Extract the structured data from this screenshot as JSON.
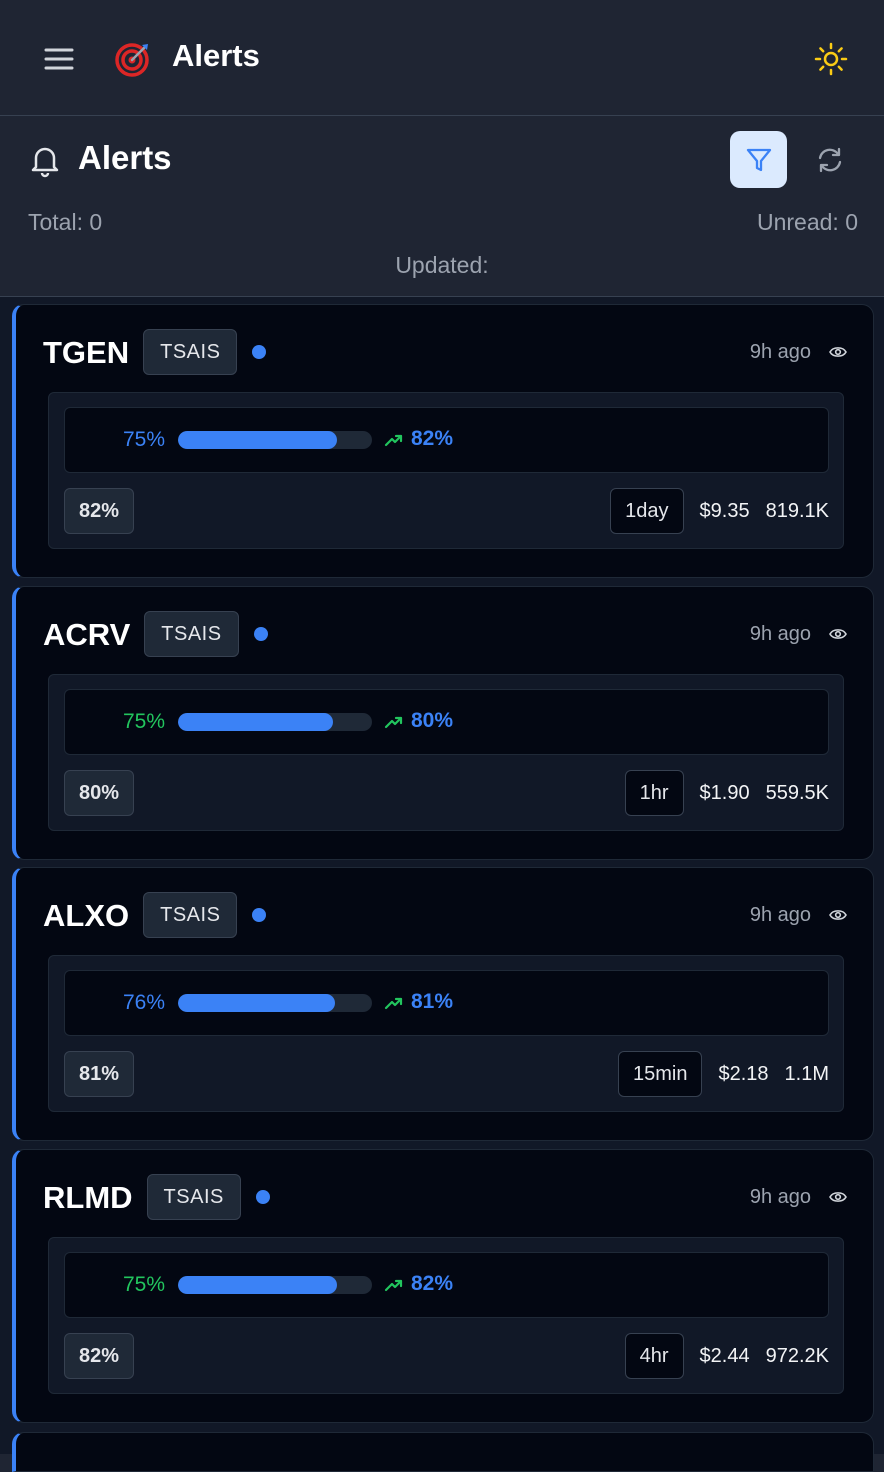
{
  "header": {
    "title": "Alerts",
    "icons": {
      "menu": "hamburger-icon",
      "logo": "target-icon",
      "theme": "sun-icon"
    },
    "colors": {
      "background": "#1f2533",
      "sun": "#facc15",
      "logo": "#dc2626"
    }
  },
  "subheader": {
    "title": "Alerts",
    "total": "Total: 0",
    "unread": "Unread: 0",
    "updated": "Updated:",
    "icons": {
      "bell": "bell-icon",
      "filter": "filter-icon",
      "refresh": "refresh-icon"
    }
  },
  "alerts": [
    {
      "ticker": "TGEN",
      "source": "TSAIS",
      "time": "9h ago",
      "start_pct": "75%",
      "start_color": "#3b82f6",
      "progress": 0.82,
      "end_pct": "82%",
      "confidence": "82%",
      "timeframe": "1day",
      "price": "$9.35",
      "volume": "819.1K"
    },
    {
      "ticker": "ACRV",
      "source": "TSAIS",
      "time": "9h ago",
      "start_pct": "75%",
      "start_color": "#22c55e",
      "progress": 0.8,
      "end_pct": "80%",
      "confidence": "80%",
      "timeframe": "1hr",
      "price": "$1.90",
      "volume": "559.5K"
    },
    {
      "ticker": "ALXO",
      "source": "TSAIS",
      "time": "9h ago",
      "start_pct": "76%",
      "start_color": "#3b82f6",
      "progress": 0.81,
      "end_pct": "81%",
      "confidence": "81%",
      "timeframe": "15min",
      "price": "$2.18",
      "volume": "1.1M"
    },
    {
      "ticker": "RLMD",
      "source": "TSAIS",
      "time": "9h ago",
      "start_pct": "75%",
      "start_color": "#22c55e",
      "progress": 0.82,
      "end_pct": "82%",
      "confidence": "82%",
      "timeframe": "4hr",
      "price": "$2.44",
      "volume": "972.2K"
    }
  ],
  "colors": {
    "accent": "#3b82f6",
    "trend_up": "#22c55e",
    "card_bg": "#030712",
    "filter_active_bg": "#dbeafe"
  }
}
